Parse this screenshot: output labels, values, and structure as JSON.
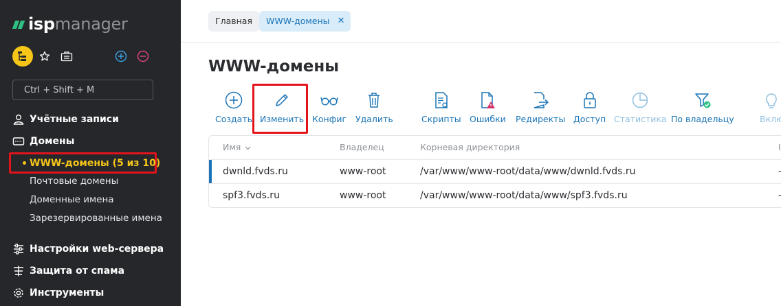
{
  "brand": {
    "bold": "isp",
    "light": "manager"
  },
  "sidebar": {
    "search_placeholder": "Ctrl + Shift + M",
    "nav": [
      {
        "label": "Учётные записи",
        "icon": "user-icon"
      },
      {
        "label": "Домены",
        "icon": "domain-icon"
      }
    ],
    "active_item": "WWW-домены (5 из 10)",
    "sub_items": [
      "Почтовые домены",
      "Доменные имена",
      "Зарезервированные имена"
    ],
    "nav_bottom": [
      {
        "label": "Настройки web-сервера",
        "icon": "sliders-icon"
      },
      {
        "label": "Защита от спама",
        "icon": "spam-filter-icon"
      },
      {
        "label": "Инструменты",
        "icon": "gear-icon"
      }
    ]
  },
  "breadcrumbs": {
    "home": "Главная",
    "current": "WWW-домены",
    "close_glyph": "✕"
  },
  "page": {
    "title": "WWW-домены"
  },
  "toolbar": {
    "create": "Создать",
    "edit": "Изменить",
    "config": "Конфиг",
    "delete": "Удалить",
    "scripts": "Скрипты",
    "errors": "Ошибки",
    "redirects": "Редиректы",
    "access": "Доступ",
    "statistics": "Статистика",
    "by_owner": "По владельцу",
    "include_partial": "Вклю"
  },
  "table": {
    "headers": {
      "name": "Имя",
      "owner": "Владелец",
      "root": "Корневая директория",
      "extra": "I"
    },
    "rows": [
      {
        "name": "dwnld.fvds.ru",
        "owner": "www-root",
        "root": "/var/www/www-root/data/www/dwnld.fvds.ru",
        "extra": "-"
      },
      {
        "name": "spf3.fvds.ru",
        "owner": "www-root",
        "root": "/var/www/www-root/data/www/spf3.fvds.ru",
        "extra": "-"
      }
    ]
  },
  "colors": {
    "sidebar_bg": "#26272b",
    "accent_blue": "#1a74b6",
    "highlight_red": "#e3131c",
    "active_yellow": "#f5c518",
    "brand_green": "#2fc183"
  }
}
